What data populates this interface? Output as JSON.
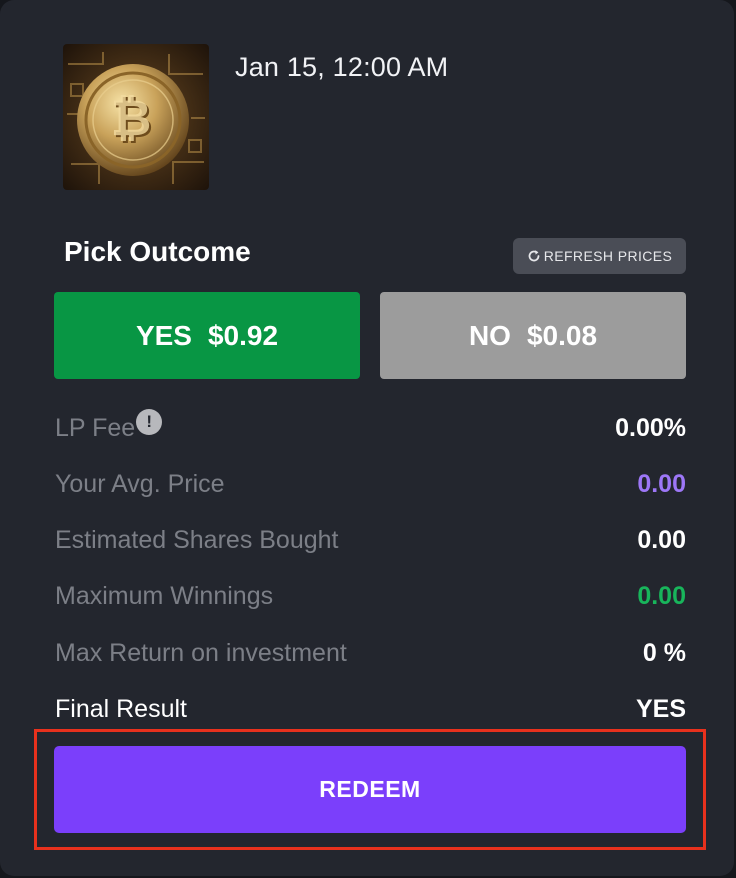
{
  "market": {
    "image": "bitcoin-coin-image",
    "date": "Jan 15, 12:00 AM"
  },
  "pick": {
    "title": "Pick Outcome",
    "refresh_label": "REFRESH PRICES",
    "refresh_icon": "refresh-icon"
  },
  "outcomes": {
    "yes": {
      "label": "YES",
      "price": "$0.92",
      "color": "#089644"
    },
    "no": {
      "label": "NO",
      "price": "$0.08",
      "color": "#9c9c9c"
    }
  },
  "stats": {
    "lp_fee": {
      "label": "LP Fee",
      "value": "0.00%",
      "info_icon": "info-icon"
    },
    "avg_price": {
      "label": "Your Avg. Price",
      "value": "0.00",
      "color": "#9d77f7"
    },
    "shares": {
      "label": "Estimated Shares Bought",
      "value": "0.00"
    },
    "max_win": {
      "label": "Maximum Winnings",
      "value": "0.00",
      "color": "#18b55b"
    },
    "roi": {
      "label": "Max Return on investment",
      "value": "0 %"
    },
    "final": {
      "label": "Final Result",
      "value": "YES"
    }
  },
  "redeem": {
    "label": "REDEEM",
    "color": "#7b3ffb"
  },
  "colors": {
    "card_bg": "#23262e",
    "highlight": "#e8311d"
  }
}
